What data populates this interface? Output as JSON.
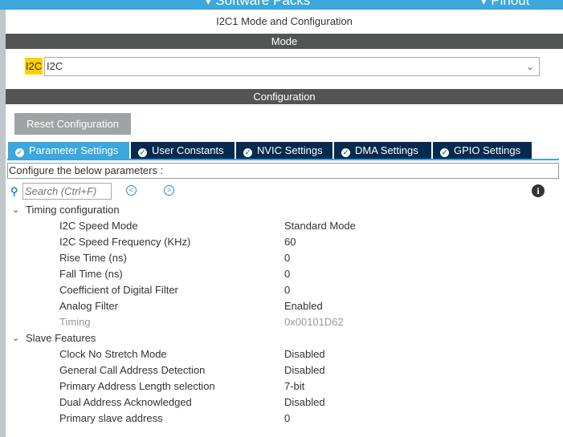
{
  "topbar": {
    "software_packs": "Software Packs",
    "pinout": "Pinout"
  },
  "title": "I2C1 Mode and Configuration",
  "mode": {
    "header": "Mode",
    "label": "I2C",
    "value": "I2C"
  },
  "configuration": {
    "header": "Configuration",
    "reset_label": "Reset Configuration"
  },
  "tabs": [
    {
      "label": "Parameter Settings",
      "active": true
    },
    {
      "label": "User Constants"
    },
    {
      "label": "NVIC Settings"
    },
    {
      "label": "DMA Settings"
    },
    {
      "label": "GPIO Settings"
    }
  ],
  "configure_text": "Configure the below parameters :",
  "search": {
    "placeholder": "Search (Ctrl+F)"
  },
  "groups": [
    {
      "label": "Timing configuration",
      "items": [
        {
          "name": "I2C Speed Mode",
          "value": "Standard Mode"
        },
        {
          "name": "I2C Speed Frequency (KHz)",
          "value": "60"
        },
        {
          "name": "Rise Time (ns)",
          "value": "0"
        },
        {
          "name": "Fall Time (ns)",
          "value": "0"
        },
        {
          "name": "Coefficient of Digital Filter",
          "value": "0"
        },
        {
          "name": "Analog Filter",
          "value": "Enabled"
        },
        {
          "name": "Timing",
          "value": "0x00101D62",
          "disabled": true
        }
      ]
    },
    {
      "label": "Slave Features",
      "items": [
        {
          "name": "Clock No Stretch Mode",
          "value": "Disabled"
        },
        {
          "name": "General Call Address Detection",
          "value": "Disabled"
        },
        {
          "name": "Primary Address Length selection",
          "value": "7-bit"
        },
        {
          "name": "Dual Address Acknowledged",
          "value": "Disabled"
        },
        {
          "name": "Primary slave address",
          "value": "0"
        }
      ]
    }
  ],
  "colors": {
    "accent": "#3ba7dc",
    "tab_dark": "#052a4f",
    "header_bar": "#535554",
    "highlight": "#ffd000"
  }
}
